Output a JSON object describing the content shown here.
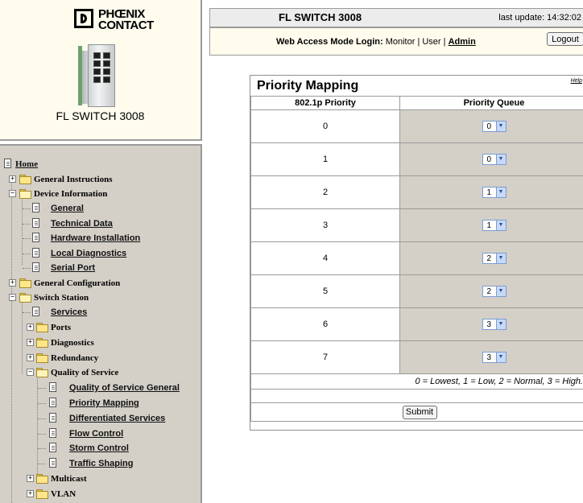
{
  "brand": {
    "line1": "PHŒNIX",
    "line2": "CONTACT"
  },
  "device_title": "FL SWITCH 3008",
  "header": {
    "title": "FL SWITCH 3008",
    "last_update": "last update: 14:32:02",
    "login_label": "Web Access Mode Login:",
    "modes": "Monitor | User |",
    "admin": "Admin",
    "logout": "Logout"
  },
  "nav": {
    "home": "Home",
    "general_instructions": "General Instructions",
    "device_information": "Device Information",
    "di_general": "General",
    "di_technical": "Technical Data",
    "di_hardware": "Hardware Installation",
    "di_diagnostics": "Local Diagnostics",
    "di_serial": "Serial Port",
    "general_configuration": "General Configuration",
    "switch_station": "Switch Station",
    "ss_services": "Services",
    "ss_ports": "Ports",
    "ss_diagnostics": "Diagnostics",
    "ss_redundancy": "Redundancy",
    "ss_qos": "Quality of Service",
    "qos_general": "Quality of Service General",
    "qos_priority": "Priority Mapping",
    "qos_diffserv": "Differentiated Services",
    "qos_flow": "Flow Control",
    "qos_storm": "Storm Control",
    "qos_traffic": "Traffic Shaping",
    "ss_multicast": "Multicast",
    "ss_vlan": "VLAN"
  },
  "main": {
    "title": "Priority Mapping",
    "help": "Help",
    "col1": "802.1p Priority",
    "col2": "Priority Queue",
    "rows": [
      {
        "priority": "0",
        "queue": "0"
      },
      {
        "priority": "1",
        "queue": "0"
      },
      {
        "priority": "2",
        "queue": "1"
      },
      {
        "priority": "3",
        "queue": "1"
      },
      {
        "priority": "4",
        "queue": "2"
      },
      {
        "priority": "5",
        "queue": "2"
      },
      {
        "priority": "6",
        "queue": "3"
      },
      {
        "priority": "7",
        "queue": "3"
      }
    ],
    "legend": "0 = Lowest, 1 = Low, 2 = Normal, 3 = High.",
    "submit": "Submit"
  },
  "colors": {
    "left_frame_bg": "#fffcee",
    "nav_bg": "#d4d0c8",
    "queue_cell_bg": "#d4d0c8"
  }
}
